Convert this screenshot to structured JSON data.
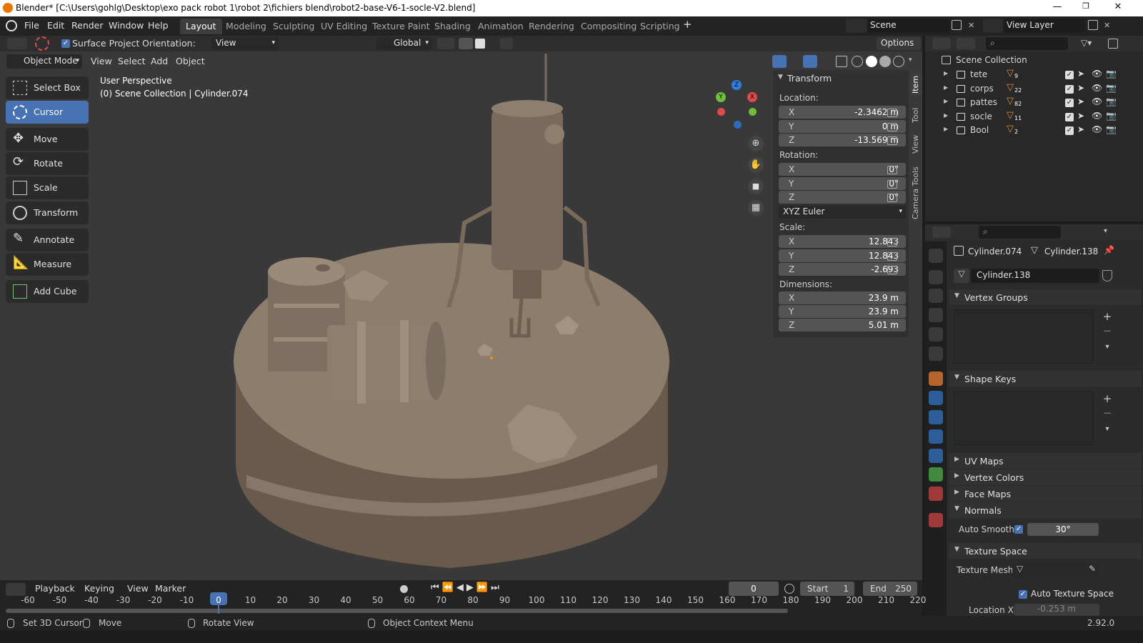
{
  "titlebar": {
    "title": "Blender* [C:\\Users\\gohlg\\Desktop\\exo pack robot 1\\robot 2\\fichiers blend\\robot2-base-V6-1-socle-V2.blend]"
  },
  "menu": [
    "File",
    "Edit",
    "Render",
    "Window",
    "Help"
  ],
  "workspaces": [
    {
      "label": "Layout",
      "active": true
    },
    {
      "label": "Modeling"
    },
    {
      "label": "Sculpting"
    },
    {
      "label": "UV Editing"
    },
    {
      "label": "Texture Paint"
    },
    {
      "label": "Shading"
    },
    {
      "label": "Animation"
    },
    {
      "label": "Rendering"
    },
    {
      "label": "Compositing"
    },
    {
      "label": "Scripting"
    }
  ],
  "scene": {
    "scene_name": "Scene",
    "view_layer": "View Layer"
  },
  "tool_header": {
    "surface_project": "Surface Project",
    "orientation_label": "Orientation:",
    "orientation_value": "View",
    "transform_orientation": "Global",
    "options": "Options"
  },
  "viewport_header": {
    "mode": "Object Mode",
    "menus": [
      "View",
      "Select",
      "Add",
      "Object"
    ]
  },
  "viewport_info": {
    "line1": "User Perspective",
    "line2": "(0) Scene Collection | Cylinder.074"
  },
  "toolbar": [
    "Select Box",
    "Cursor",
    "Move",
    "Rotate",
    "Scale",
    "Transform",
    "Annotate",
    "Measure",
    "Add Cube"
  ],
  "gizmo": {
    "x": "X",
    "y": "Y",
    "z": "Z"
  },
  "npanel": {
    "title": "Transform",
    "location_label": "Location:",
    "location": [
      {
        "axis": "X",
        "value": "-2.3462 m"
      },
      {
        "axis": "Y",
        "value": "0 m"
      },
      {
        "axis": "Z",
        "value": "-13.569 m"
      }
    ],
    "rotation_label": "Rotation:",
    "rotation": [
      {
        "axis": "X",
        "value": "0°"
      },
      {
        "axis": "Y",
        "value": "0°"
      },
      {
        "axis": "Z",
        "value": "0°"
      }
    ],
    "rotation_mode": "XYZ Euler",
    "scale_label": "Scale:",
    "scale": [
      {
        "axis": "X",
        "value": "12.843"
      },
      {
        "axis": "Y",
        "value": "12.843"
      },
      {
        "axis": "Z",
        "value": "-2.693"
      }
    ],
    "dimensions_label": "Dimensions:",
    "dimensions": [
      {
        "axis": "X",
        "value": "23.9 m"
      },
      {
        "axis": "Y",
        "value": "23.9 m"
      },
      {
        "axis": "Z",
        "value": "5.01 m"
      }
    ]
  },
  "vtabs": [
    "Item",
    "Tool",
    "View",
    "Camera Tools"
  ],
  "outliner": {
    "root": "Scene Collection",
    "collections": [
      {
        "name": "tete",
        "count": "9"
      },
      {
        "name": "corps",
        "count": "22"
      },
      {
        "name": "pattes",
        "count": "82"
      },
      {
        "name": "socle",
        "count": "11"
      },
      {
        "name": "Bool",
        "count": "2"
      }
    ]
  },
  "properties": {
    "object": "Cylinder.074",
    "mesh": "Cylinder.138",
    "datablock": "Cylinder.138",
    "sections": {
      "vertex_groups": "Vertex Groups",
      "shape_keys": "Shape Keys",
      "uv_maps": "UV Maps",
      "vertex_colors": "Vertex Colors",
      "face_maps": "Face Maps",
      "normals": "Normals",
      "texture_space": "Texture Space"
    },
    "auto_smooth_label": "Auto Smooth",
    "auto_smooth_angle": "30°",
    "texture_mesh_label": "Texture Mesh",
    "auto_texture_space": "Auto Texture Space",
    "location_x_label": "Location X",
    "location_x_value": "-0.253 m"
  },
  "timeline": {
    "menus": [
      "Playback",
      "Keying",
      "View",
      "Marker"
    ],
    "current_frame": "0",
    "start_label": "Start",
    "start": "1",
    "end_label": "End",
    "end": "250",
    "ticks": [
      "-60",
      "-50",
      "-40",
      "-30",
      "-20",
      "-10",
      "0",
      "10",
      "20",
      "30",
      "40",
      "50",
      "60",
      "70",
      "80",
      "90",
      "100",
      "110",
      "120",
      "130",
      "140",
      "150",
      "160",
      "170",
      "180",
      "190",
      "200",
      "210",
      "220"
    ]
  },
  "statusbar": {
    "items": [
      "Set 3D Cursor",
      "Move",
      "Rotate View",
      "Object Context Menu"
    ],
    "version": "2.92.0"
  }
}
